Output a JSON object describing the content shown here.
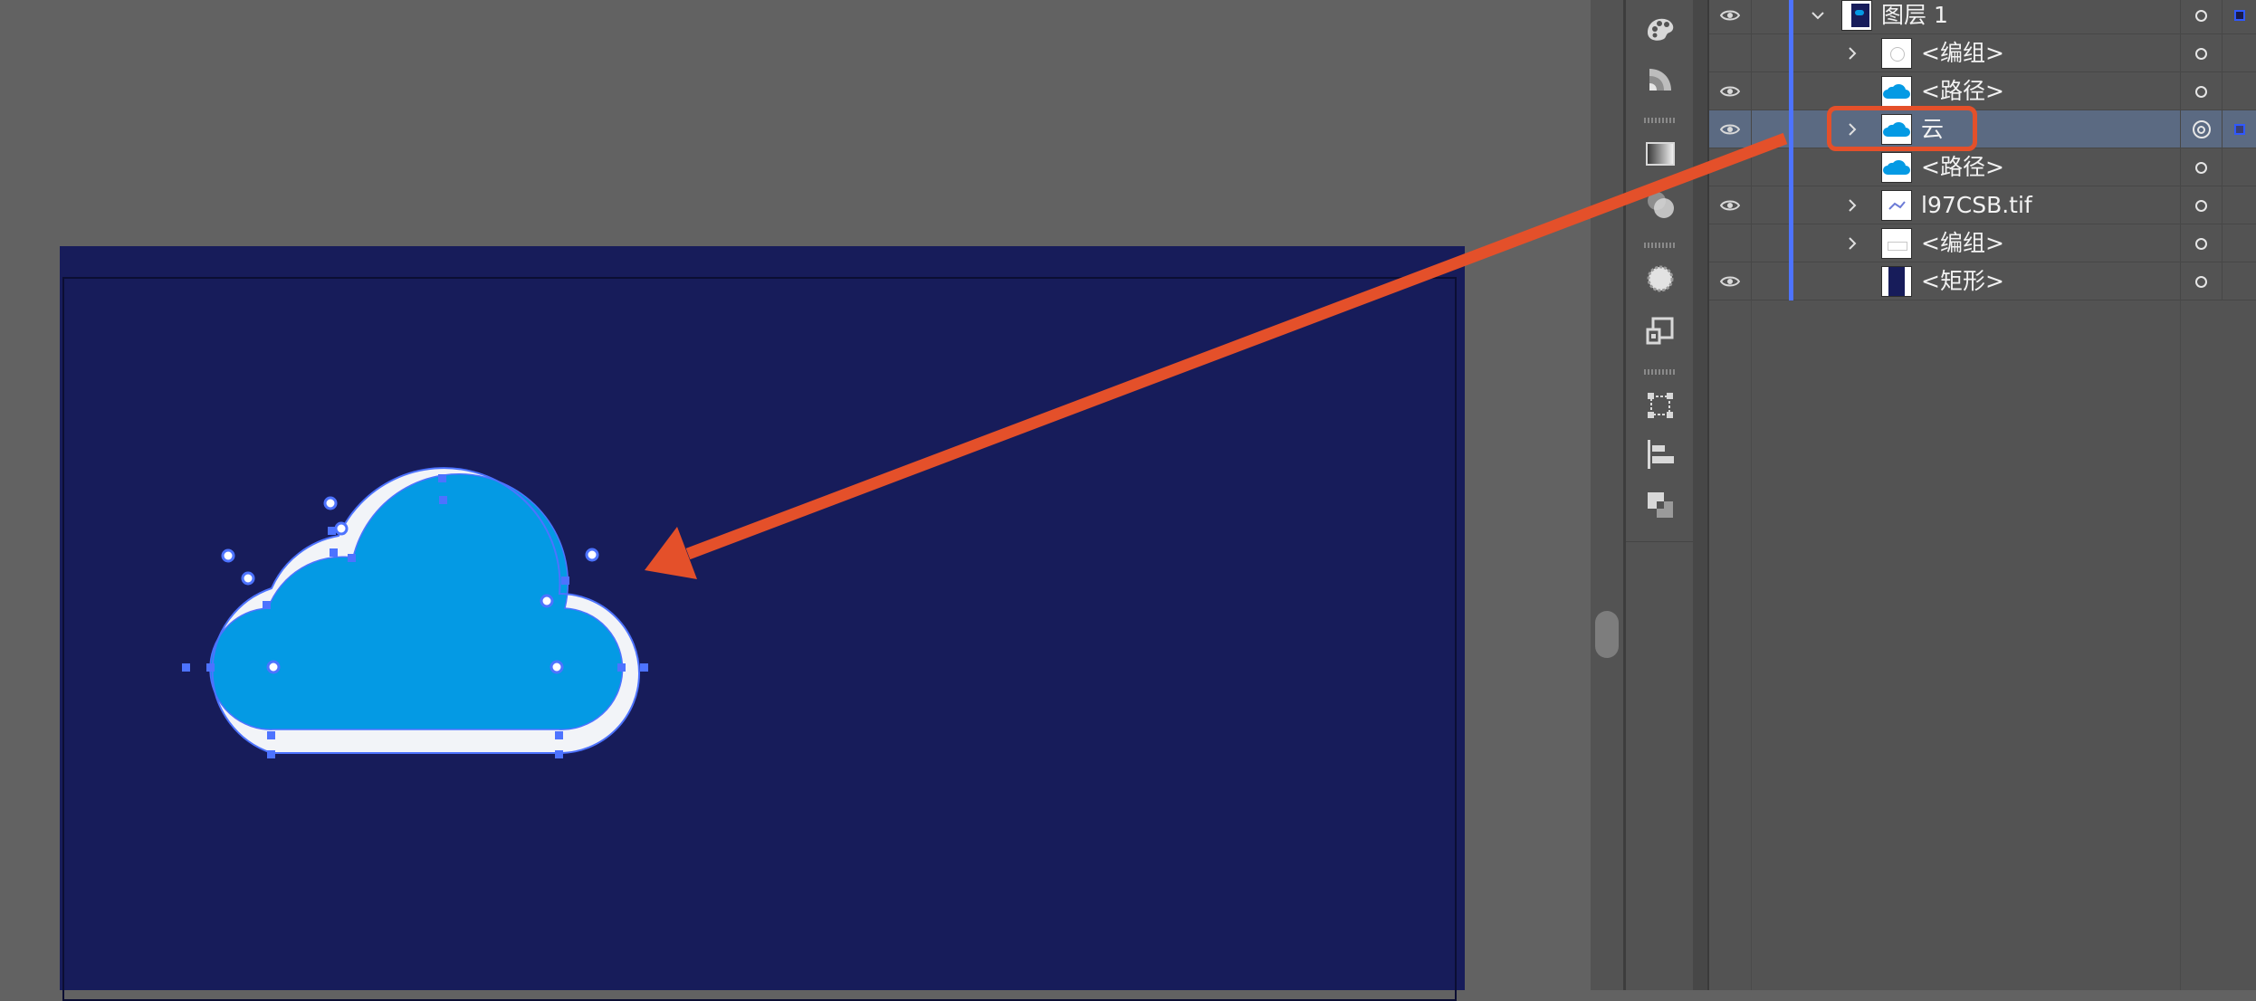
{
  "layers_panel": {
    "rows": [
      {
        "name": "图层 1",
        "visible": true,
        "expandable": true,
        "expanded": true,
        "thumb": "layer-thumb-icon",
        "selected_indicator": true
      },
      {
        "name": "<编组>",
        "visible": false,
        "expandable": true,
        "thumb": "group-thumb-icon"
      },
      {
        "name": "<路径>",
        "visible": true,
        "expandable": false,
        "thumb": "cloud-thumb-icon"
      },
      {
        "name": "云",
        "visible": true,
        "expandable": true,
        "thumb": "cloud-thumb-icon",
        "selected": true
      },
      {
        "name": "<路径>",
        "visible": false,
        "expandable": false,
        "thumb": "cloud-thumb-icon"
      },
      {
        "name": "l97CSB.tif",
        "visible": true,
        "expandable": true,
        "thumb": "image-thumb-icon"
      },
      {
        "name": "<编组>",
        "visible": false,
        "expandable": true,
        "thumb": "group-thumb-icon"
      },
      {
        "name": "<矩形>",
        "visible": true,
        "expandable": false,
        "thumb": "rectangle-thumb-icon"
      }
    ]
  },
  "tools": [
    "color-palette-icon",
    "color-guide-icon",
    "gradient-icon",
    "transparency-icon",
    "appearance-icon",
    "graphic-styles-icon",
    "transform-icon",
    "align-icon",
    "pathfinder-icon"
  ],
  "colors": {
    "artboard": "#171c5a",
    "cloud_fill": "#049ae4",
    "cloud_outline": "#f2f4f8",
    "selection": "#4d73ff",
    "annotation": "#e4502a"
  }
}
